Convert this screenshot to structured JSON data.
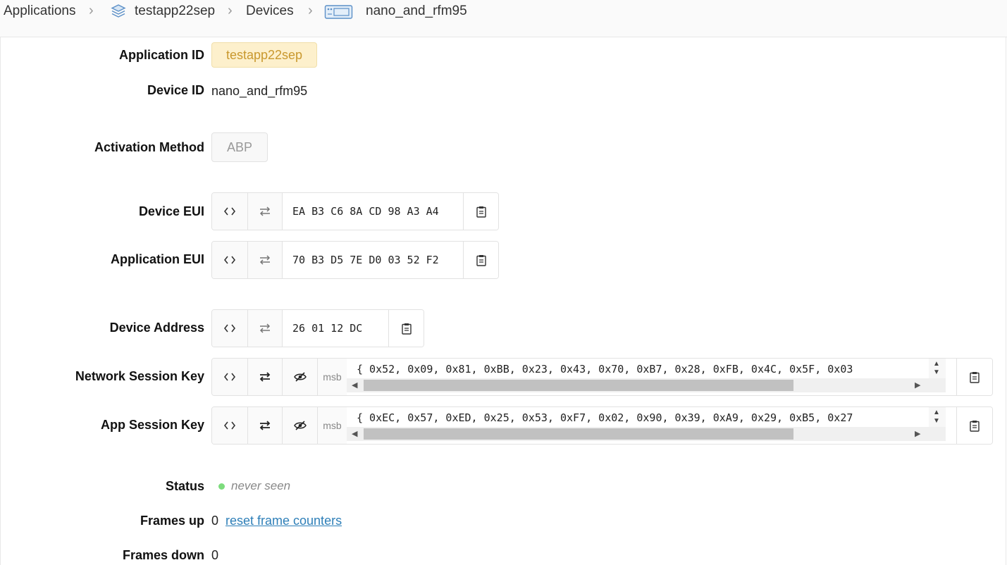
{
  "breadcrumb": {
    "items": [
      {
        "label": "Applications"
      },
      {
        "label": "testapp22sep",
        "icon": "layers-icon"
      },
      {
        "label": "Devices"
      },
      {
        "label": "nano_and_rfm95",
        "icon": "device-board-icon"
      }
    ],
    "separator": "›"
  },
  "device": {
    "application_id_label": "Application ID",
    "application_id": "testapp22sep",
    "device_id_label": "Device ID",
    "device_id": "nano_and_rfm95",
    "activation_method_label": "Activation Method",
    "activation_method": "ABP",
    "device_eui_label": "Device EUI",
    "device_eui": "EA B3 C6 8A CD 98 A3 A4",
    "application_eui_label": "Application EUI",
    "application_eui": "70 B3 D5 7E D0 03 52 F2",
    "device_address_label": "Device Address",
    "device_address": "26 01 12 DC",
    "nwk_skey_label": "Network Session Key",
    "nwk_skey_byteorder": "msb",
    "nwk_skey": "{ 0x52, 0x09, 0x81, 0xBB, 0x23, 0x43, 0x70, 0xB7, 0x28, 0xFB, 0x4C, 0x5F, 0x03",
    "app_skey_label": "App Session Key",
    "app_skey_byteorder": "msb",
    "app_skey": "{ 0xEC, 0x57, 0xED, 0x25, 0x53, 0xF7, 0x02, 0x90, 0x39, 0xA9, 0x29, 0xB5, 0x27",
    "status_label": "Status",
    "status": "never seen",
    "frames_up_label": "Frames up",
    "frames_up": "0",
    "reset_label": "reset frame counters",
    "frames_down_label": "Frames down",
    "frames_down": "0"
  },
  "icons": {
    "format_toggle": "code-brackets-icon",
    "byte_order": "swap-arrows-icon",
    "visibility": "eye-slash-icon",
    "copy": "clipboard-icon"
  },
  "colors": {
    "badge_bg": "#fdf0cc",
    "badge_text": "#c9982d",
    "status_dot": "#7ddc7d",
    "link": "#2e7fb8"
  }
}
